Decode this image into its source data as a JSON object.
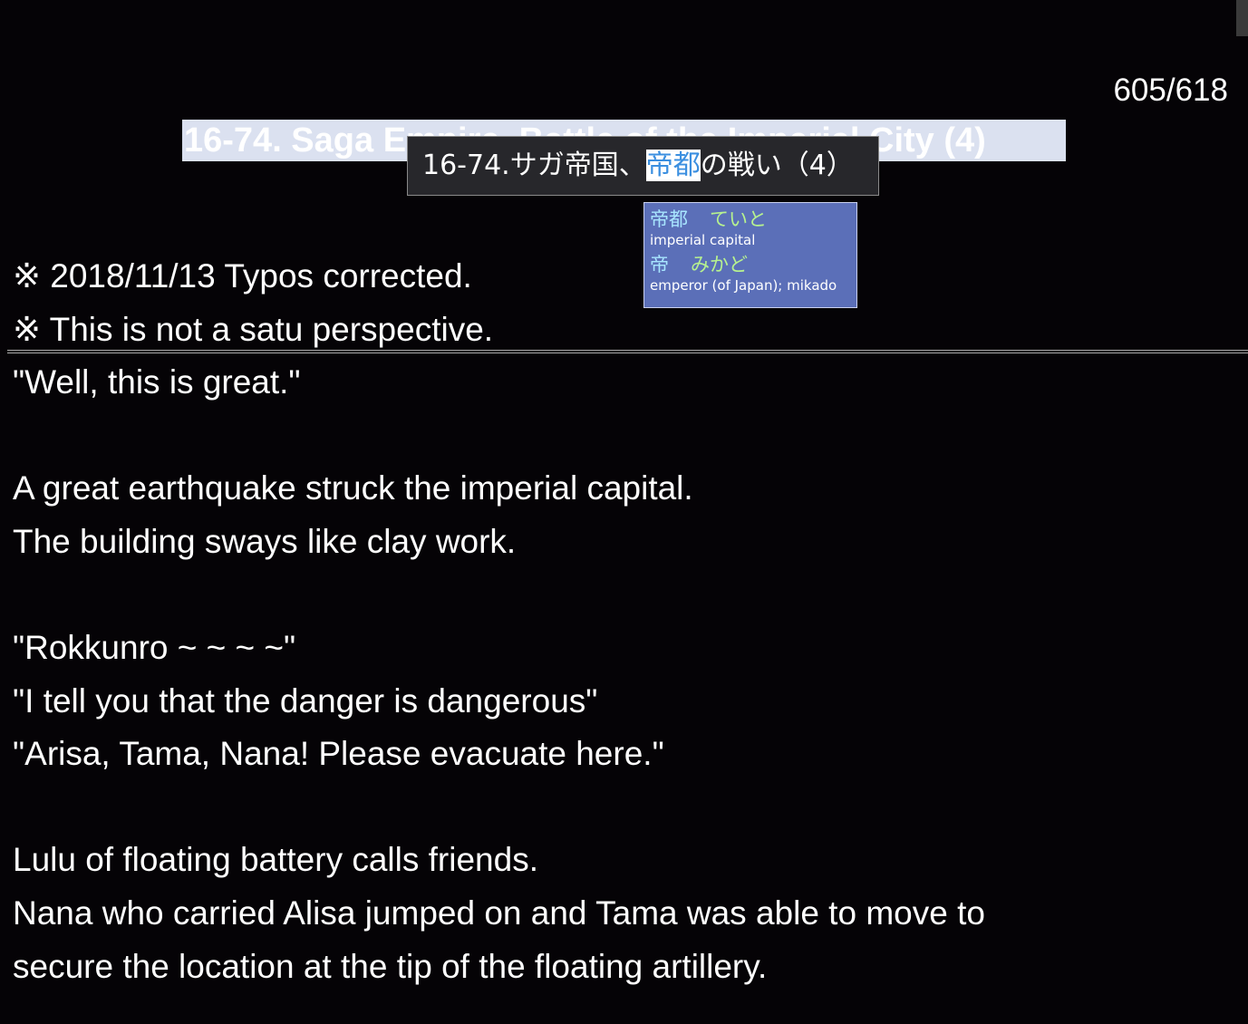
{
  "page_counter": "605/618",
  "chapter_title": "16-74. Saga Empire, Battle of the Imperial City (4)",
  "tooltip": {
    "before": "16-74.サガ帝国、",
    "highlight": "帝都",
    "after": "の戦い（4）"
  },
  "dictionary": [
    {
      "word": "帝都",
      "reading": "ていと",
      "gloss": "imperial capital"
    },
    {
      "word": "帝",
      "reading": "みかど",
      "gloss": "emperor (of Japan); mikado"
    }
  ],
  "notes": [
    "※ 2018/11/13 Typos corrected.",
    "※ This is not a satu perspective."
  ],
  "paragraphs": [
    "\"Well, this is great.\"",
    "",
    "A great earthquake struck the imperial capital.",
    "The building sways like clay work.",
    "",
    "\"Rokkunro ~ ~ ~ ~\"",
    "\"I tell you that the danger is dangerous\"",
    "\"Arisa, Tama, Nana! Please evacuate here.\"",
    "",
    "Lulu of floating battery calls friends.",
    "Nana who carried Alisa jumped on and Tama was able to move to",
    "secure the location at the tip of the floating artillery."
  ]
}
